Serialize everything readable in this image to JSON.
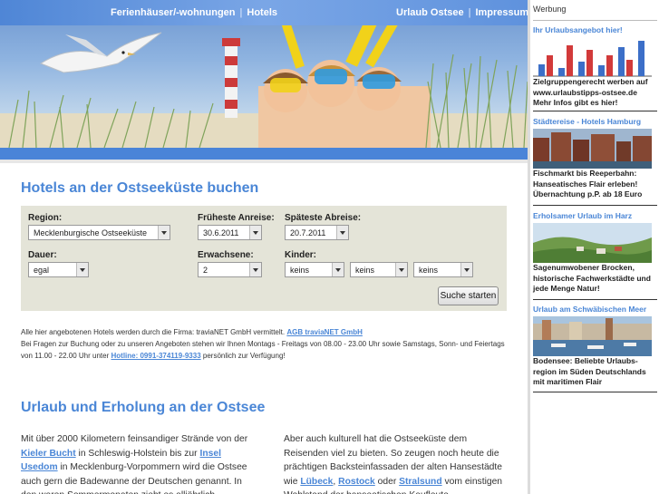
{
  "nav": {
    "left_items": [
      "Ferienhäuser/-wohnungen",
      "Hotels"
    ],
    "right_items": [
      "Urlaub Ostsee",
      "Impressum"
    ],
    "separator": "|"
  },
  "hotels": {
    "title": "Hotels an der Ostseeküste buchen",
    "region_label": "Region:",
    "region_value": "Mecklenburgische Ostseeküste",
    "arrival_label": "Früheste Anreise:",
    "arrival_value": "30.6.2011",
    "departure_label": "Späteste Abreise:",
    "departure_value": "20.7.2011",
    "duration_label": "Dauer:",
    "duration_value": "egal",
    "adults_label": "Erwachsene:",
    "adults_value": "2",
    "children_label": "Kinder:",
    "children_values": [
      "keins",
      "keins",
      "keins"
    ],
    "search_button": "Suche starten"
  },
  "info": {
    "line1_text": "Alle hier angebotenen Hotels werden durch die Firma: traviaNET GmbH vermittelt.",
    "line1_link": "AGB traviaNET GmbH",
    "line2_text": "Bei Fragen zur Buchung oder zu unseren Angeboten stehen wir Ihnen Montags - Freitags von 08.00 - 23.00 Uhr sowie Samstags, Sonn- und Feiertags",
    "line3_pre": "von 11.00 - 22.00 Uhr unter",
    "line3_link": "Hotline: 0991-374119-9333",
    "line3_post": "persönlich zur Verfügung!"
  },
  "urlaub": {
    "title": "Urlaub und Erholung an der Ostsee",
    "left": {
      "t1": "Mit über 2000 Kilometern feinsandiger Strände von der",
      "l1": "Kieler Bucht",
      "t2": "in Schleswig-Holstein bis zur",
      "l2": "Insel Usedom",
      "t3": "in Mecklenburg-Vorpommern wird die Ostsee auch gern die Badewanne der Deutschen genannt. In den waren Sommermonaten zieht es alljährlich tausende Touristen an"
    },
    "right": {
      "t1": "Aber auch kulturell hat die Ostseeküste dem Reisenden viel zu bieten. So zeugen noch heute die prächtigen Backsteinfassaden der alten Hansestädte wie",
      "l1": "Lübeck",
      "t2": ",",
      "l2": "Rostock",
      "t3": "oder",
      "l3": "Stralsund",
      "t4": "vom einstigen Wohlstand der hanseatischen Kaufleute."
    }
  },
  "sidebar": {
    "label": "Werbung",
    "ads": [
      {
        "title": "Ihr Urlaubsangebot hier!",
        "text": "Zielgruppengerecht werben auf www.urlaubstipps-ostsee.de Mehr Infos gibt es hier!"
      },
      {
        "title": "Städtereise - Hotels Hamburg",
        "text": "Fischmarkt bis Reeperbahn: Hanseatisches Flair erleben! Übernachtung p.P. ab 18 Euro"
      },
      {
        "title": "Erholsamer Urlaub im Harz",
        "text": "Sagenumwobener Brocken, historische Fachwerkstädte und jede Menge Natur!"
      },
      {
        "title": "Urlaub am Schwäbischen Meer",
        "text": "Bodensee: Beliebte Urlaubs-region im Süden Deutschlands mit maritimen Flair"
      }
    ]
  },
  "colors": {
    "accent": "#4a86d6",
    "nav_bar": "#5f92dd",
    "form_bg": "#e4e4d8",
    "chart_blue": "#3c6fc8",
    "chart_red": "#d23a3a"
  }
}
